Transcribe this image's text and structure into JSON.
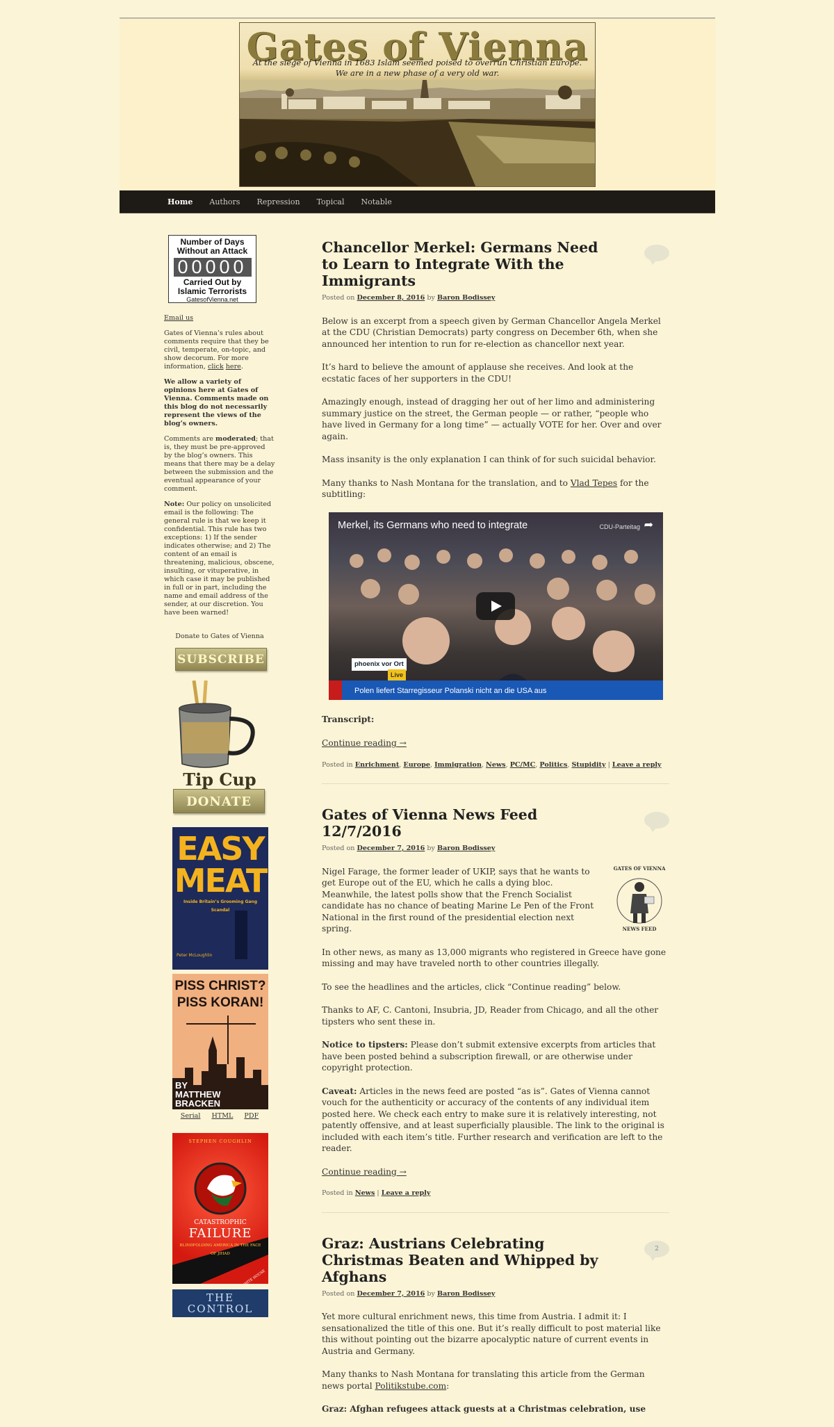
{
  "site": {
    "title": "Gates of Vienna",
    "tagline_1": "At the siege of Vienna in 1683 Islam seemed poised to overrun Christian Europe.",
    "tagline_2": "We are in a new phase of a very old war."
  },
  "nav": {
    "items": [
      "Home",
      "Authors",
      "Repression",
      "Topical",
      "Notable"
    ],
    "active": "Home"
  },
  "sidebar": {
    "counter": {
      "line1": "Number of Days",
      "line2": "Without an Attack",
      "digits": "00000",
      "line3": "Carried Out by",
      "line4": "Islamic Terrorists",
      "site": "GatesofVienna.net"
    },
    "email_link": "Email us",
    "rules_text": "Gates of Vienna’s rules about comments require that they be civil, temperate, on-topic, and show decorum. For more information,",
    "rules_link_1": "click",
    "rules_link_2": "here",
    "opinions_text": "We allow a variety of opinions here at Gates of Vienna. Comments made on this blog do not necessarily represent the views of the blog’s owners.",
    "moderated_pre": "Comments are",
    "moderated_bold": "moderated",
    "moderated_post": "; that is, they must be pre-approved by the blog’s owners. This means that there may be a delay between the submission and the eventual appearance of your comment.",
    "note_label": "Note:",
    "note_text": "Our policy on unsolicited email is the following: The general rule is that we keep it confidential. This rule has two exceptions: 1) If the sender indicates otherwise; and 2) The content of an email is threatening, malicious, obscene, insulting, or vituperative, in which case it may be published in full or in part, including the name and email address of the sender, at our discretion. You have been warned!",
    "donate_label": "Donate to Gates of Vienna",
    "subscribe": "SUBSCRIBE",
    "cup_label": "Gates of Vienna",
    "tip_cup": "Tip Cup",
    "donate": "DONATE",
    "book1": {
      "title": "EASY MEAT",
      "subtitle": "Inside Britain’s Grooming Gang Scandal",
      "author": "Peter McLoughlin"
    },
    "book2": {
      "title_1": "PISS CHRIST?",
      "title_2": "PISS KORAN!",
      "by": "BY",
      "author": "MATTHEW BRACKEN"
    },
    "book_links": [
      "Serial",
      "HTML",
      "PDF"
    ],
    "book3": {
      "author": "STEPHEN COUGHLIN",
      "title_1": "CATASTROPHIC",
      "title_2": "FAILURE",
      "subtitle": "BLINDFOLDING AMERICA IN THE FACE OF JIHAD",
      "banner": "BANNED BY THE WHITE HOUSE"
    },
    "book4": {
      "title_1": "THE",
      "title_2": "CONTROL"
    }
  },
  "posts": [
    {
      "title": "Chancellor Merkel: Germans Need to Learn to Integrate With the Immigrants",
      "posted_on": "Posted on",
      "date": "December 8, 2016",
      "by": "by",
      "author": "Baron Bodissey",
      "comments": "",
      "paragraphs": [
        "Below is an excerpt from a speech given by German Chancellor Angela Merkel at the CDU (Christian Democrats) party congress on December 6th, when she announced her intention to run for re-election as chancellor next year.",
        "It’s hard to believe the amount of applause she receives. And look at the ecstatic faces of her supporters in the CDU!",
        "Amazingly enough, instead of dragging her out of her limo and administering summary justice on the street, the German people — or rather, “people who have lived in Germany for a long time” — actually VOTE for her. Over and over again.",
        "Mass insanity is the only explanation I can think of for such suicidal behavior."
      ],
      "thanks_pre": "Many thanks to Nash Montana for the translation, and to",
      "thanks_link": "Vlad Tepes",
      "thanks_post": "for the subtitling:",
      "video": {
        "title": "Merkel, its Germans who need to integrate",
        "channel": "CDU-Parteitag",
        "logo": "phoenix vor Ort",
        "live": "Live",
        "ticker": "Polen liefert Starregisseur Polanski nicht an die USA aus"
      },
      "transcript": "Transcript:",
      "continue": "Continue reading →",
      "posted_in": "Posted in",
      "categories": [
        "Enrichment",
        "Europe",
        "Immigration",
        "News",
        "PC/MC",
        "Politics",
        "Stupidity"
      ],
      "reply": "Leave a reply"
    },
    {
      "title": "Gates of Vienna News Feed 12/7/2016",
      "posted_on": "Posted on",
      "date": "December 7, 2016",
      "by": "by",
      "author": "Baron Bodissey",
      "comments": "",
      "image_top": "GATES OF VIENNA",
      "image_bottom": "NEWS FEED",
      "paragraphs": [
        "Nigel Farage, the former leader of UKIP, says that he wants to get Europe out of the EU, which he calls a dying bloc. Meanwhile, the latest polls show that the French Socialist candidate has no chance of beating Marine Le Pen of the Front National in the first round of the presidential election next spring.",
        "In other news, as many as 13,000 migrants who registered in Greece have gone missing and may have traveled north to other countries illegally.",
        "To see the headlines and the articles, click “Continue reading” below.",
        "Thanks to AF, C. Cantoni, Insubria, JD, Reader from Chicago, and all the other tipsters who sent these in."
      ],
      "notice_label": "Notice to tipsters:",
      "notice_text": "Please don’t submit extensive excerpts from articles that have been posted behind a subscription firewall, or are otherwise under copyright protection.",
      "caveat_label": "Caveat:",
      "caveat_text": "Articles in the news feed are posted “as is”. Gates of Vienna cannot vouch for the authenticity or accuracy of the contents of any individual item posted here. We check each entry to make sure it is relatively interesting, not patently offensive, and at least superficially plausible. The link to the original is included with each item’s title. Further research and verification are left to the reader.",
      "continue": "Continue reading →",
      "posted_in": "Posted in",
      "categories": [
        "News"
      ],
      "reply": "Leave a reply"
    },
    {
      "title": "Graz: Austrians Celebrating Christmas Beaten and Whipped by Afghans",
      "posted_on": "Posted on",
      "date": "December 7, 2016",
      "by": "by",
      "author": "Baron Bodissey",
      "comments": "2",
      "paragraphs": [
        "Yet more cultural enrichment news, this time from Austria. I admit it: I sensationalized the title of this one. But it’s really difficult to post material like this without pointing out the bizarre apocalyptic nature of current events in Austria and Germany."
      ],
      "thanks_text": "Many thanks to Nash Montana for translating this article from the German news portal",
      "thanks_link": "Politikstube.com",
      "thanks_colon": ":",
      "quote": "Graz: Afghan refugees attack guests at a Christmas celebration, use"
    }
  ],
  "colors": {
    "background": "#fbf4d6",
    "navbar": "#1e1a16",
    "button": "#a89f68"
  }
}
